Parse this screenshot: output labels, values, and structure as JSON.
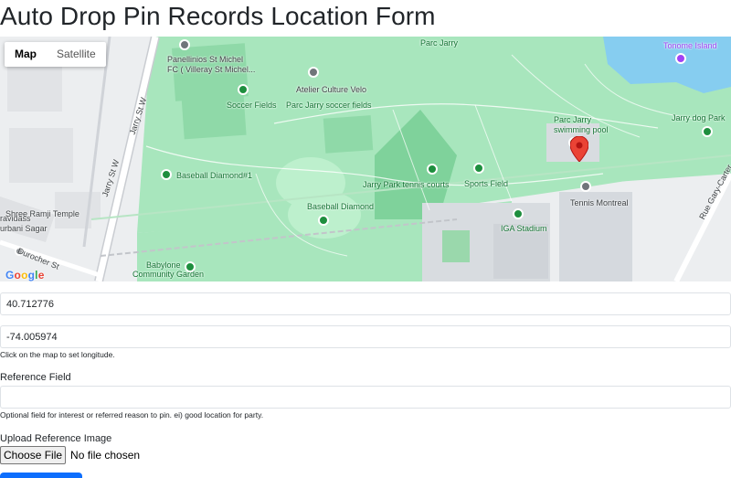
{
  "page": {
    "title": "Auto Drop Pin Records Location Form"
  },
  "map": {
    "type_control": {
      "map_label": "Map",
      "satellite_label": "Satellite",
      "active": "Map"
    },
    "pois": [
      {
        "label": "Parc Jarry",
        "kind": "park"
      },
      {
        "label": "Tonome Island",
        "kind": "attraction"
      },
      {
        "label": "Panellinios St Michel",
        "kind": "place"
      },
      {
        "label": "FC ( Villeray St Michel...",
        "kind": "place"
      },
      {
        "label": "Atelier Culture Velo",
        "kind": "place"
      },
      {
        "label": "Soccer Fields",
        "kind": "park"
      },
      {
        "label": "Parc Jarry soccer fields",
        "kind": "park"
      },
      {
        "label": "Parc Jarry",
        "kind": "park"
      },
      {
        "label": "swimming pool",
        "kind": "park"
      },
      {
        "label": "Jarry dog Park",
        "kind": "park"
      },
      {
        "label": "Baseball Diamond#1",
        "kind": "park"
      },
      {
        "label": "Jarry Park tennis courts",
        "kind": "park"
      },
      {
        "label": "Sports Field",
        "kind": "park"
      },
      {
        "label": "Tennis Montreal",
        "kind": "place"
      },
      {
        "label": "Baseball Diamond",
        "kind": "park"
      },
      {
        "label": "IGA Stadium",
        "kind": "park"
      },
      {
        "label": "Babylone",
        "kind": "park"
      },
      {
        "label": "Community Garden",
        "kind": "park"
      },
      {
        "label": "ravidass",
        "kind": "place"
      },
      {
        "label": "urbani Sagar",
        "kind": "place"
      },
      {
        "label": "Shree Ramji Temple",
        "kind": "place"
      }
    ],
    "streets": [
      "Jarry St W",
      "Jarry St W",
      "Durocher St",
      "Rue Gary-Carter"
    ],
    "logo": "Google",
    "marker_icon": "red-location-pin-icon"
  },
  "form": {
    "latitude": {
      "value": "40.712776"
    },
    "longitude": {
      "value": "-74.005974",
      "help": "Click on the map to set longitude."
    },
    "reference": {
      "label": "Reference Field",
      "value": "",
      "help": "Optional field for interest or referred reason to pin. ei) good location for party."
    },
    "upload": {
      "label": "Upload Reference Image",
      "button": "Choose File",
      "status": "No file chosen"
    }
  },
  "colors": {
    "park": "#a8e6bd",
    "primary": "#0d6efd",
    "marker": "#ea4335",
    "poi_green": "#1e8e3e"
  }
}
